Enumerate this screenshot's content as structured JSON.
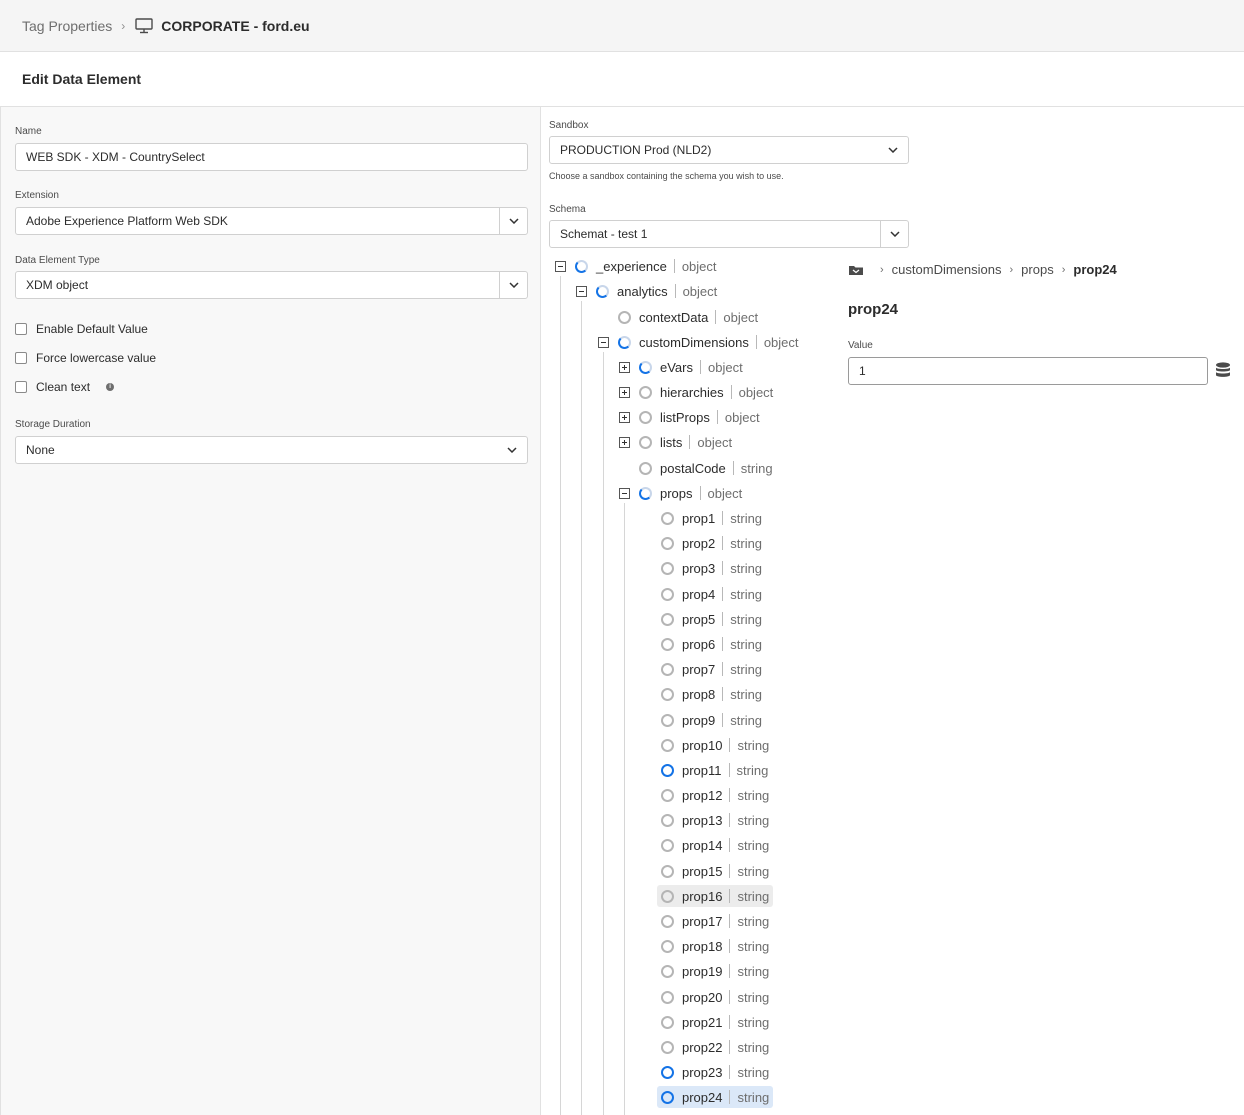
{
  "breadcrumb": {
    "root": "Tag Properties",
    "property": "CORPORATE - ford.eu"
  },
  "page_title": "Edit Data Element",
  "form": {
    "name_label": "Name",
    "name_value": "WEB SDK - XDM - CountrySelect",
    "extension_label": "Extension",
    "extension_value": "Adobe Experience Platform Web SDK",
    "type_label": "Data Element Type",
    "type_value": "XDM object",
    "checkboxes": [
      {
        "label": "Enable Default Value",
        "checked": false
      },
      {
        "label": "Force lowercase value",
        "checked": false
      },
      {
        "label": "Clean text",
        "checked": false
      }
    ],
    "storage_label": "Storage Duration",
    "storage_value": "None"
  },
  "sandbox": {
    "label": "Sandbox",
    "value": "PRODUCTION Prod (NLD2)",
    "helper": "Choose a sandbox containing the schema you wish to use."
  },
  "schema": {
    "label": "Schema",
    "value": "Schemat - test 1"
  },
  "tree": [
    {
      "name": "_experience",
      "type": "object",
      "state": "partial",
      "toggle": "minus"
    },
    {
      "name": "analytics",
      "type": "object",
      "state": "partial",
      "toggle": "minus"
    },
    {
      "name": "contextData",
      "type": "object",
      "state": "none",
      "toggle": ""
    },
    {
      "name": "customDimensions",
      "type": "object",
      "state": "partial",
      "toggle": "minus"
    },
    {
      "name": "eVars",
      "type": "object",
      "state": "partial",
      "toggle": "plus"
    },
    {
      "name": "hierarchies",
      "type": "object",
      "state": "none",
      "toggle": "plus"
    },
    {
      "name": "listProps",
      "type": "object",
      "state": "none",
      "toggle": "plus"
    },
    {
      "name": "lists",
      "type": "object",
      "state": "none",
      "toggle": "plus"
    },
    {
      "name": "postalCode",
      "type": "string",
      "state": "none",
      "toggle": ""
    },
    {
      "name": "props",
      "type": "object",
      "state": "partial",
      "toggle": "minus"
    },
    {
      "name": "prop1",
      "type": "string",
      "state": "none",
      "toggle": ""
    },
    {
      "name": "prop2",
      "type": "string",
      "state": "none",
      "toggle": ""
    },
    {
      "name": "prop3",
      "type": "string",
      "state": "none",
      "toggle": ""
    },
    {
      "name": "prop4",
      "type": "string",
      "state": "none",
      "toggle": ""
    },
    {
      "name": "prop5",
      "type": "string",
      "state": "none",
      "toggle": ""
    },
    {
      "name": "prop6",
      "type": "string",
      "state": "none",
      "toggle": ""
    },
    {
      "name": "prop7",
      "type": "string",
      "state": "none",
      "toggle": ""
    },
    {
      "name": "prop8",
      "type": "string",
      "state": "none",
      "toggle": ""
    },
    {
      "name": "prop9",
      "type": "string",
      "state": "none",
      "toggle": ""
    },
    {
      "name": "prop10",
      "type": "string",
      "state": "none",
      "toggle": ""
    },
    {
      "name": "prop11",
      "type": "string",
      "state": "full",
      "toggle": ""
    },
    {
      "name": "prop12",
      "type": "string",
      "state": "none",
      "toggle": ""
    },
    {
      "name": "prop13",
      "type": "string",
      "state": "none",
      "toggle": ""
    },
    {
      "name": "prop14",
      "type": "string",
      "state": "none",
      "toggle": ""
    },
    {
      "name": "prop15",
      "type": "string",
      "state": "none",
      "toggle": ""
    },
    {
      "name": "prop16",
      "type": "string",
      "state": "none",
      "toggle": "",
      "hover": true
    },
    {
      "name": "prop17",
      "type": "string",
      "state": "none",
      "toggle": ""
    },
    {
      "name": "prop18",
      "type": "string",
      "state": "none",
      "toggle": ""
    },
    {
      "name": "prop19",
      "type": "string",
      "state": "none",
      "toggle": ""
    },
    {
      "name": "prop20",
      "type": "string",
      "state": "none",
      "toggle": ""
    },
    {
      "name": "prop21",
      "type": "string",
      "state": "none",
      "toggle": ""
    },
    {
      "name": "prop22",
      "type": "string",
      "state": "none",
      "toggle": ""
    },
    {
      "name": "prop23",
      "type": "string",
      "state": "full",
      "toggle": ""
    },
    {
      "name": "prop24",
      "type": "string",
      "state": "full",
      "toggle": "",
      "selected": true
    }
  ],
  "detail": {
    "path": [
      "customDimensions",
      "props",
      "prop24"
    ],
    "title": "prop24",
    "value_label": "Value",
    "value": "1"
  },
  "icons": {
    "monitor": "monitor-icon",
    "folder": "folder-icon",
    "database": "data-element-icon",
    "chevron": "chevron-down-icon"
  },
  "colors": {
    "accent": "#1473e6",
    "selected_row": "#dbe8f8"
  }
}
